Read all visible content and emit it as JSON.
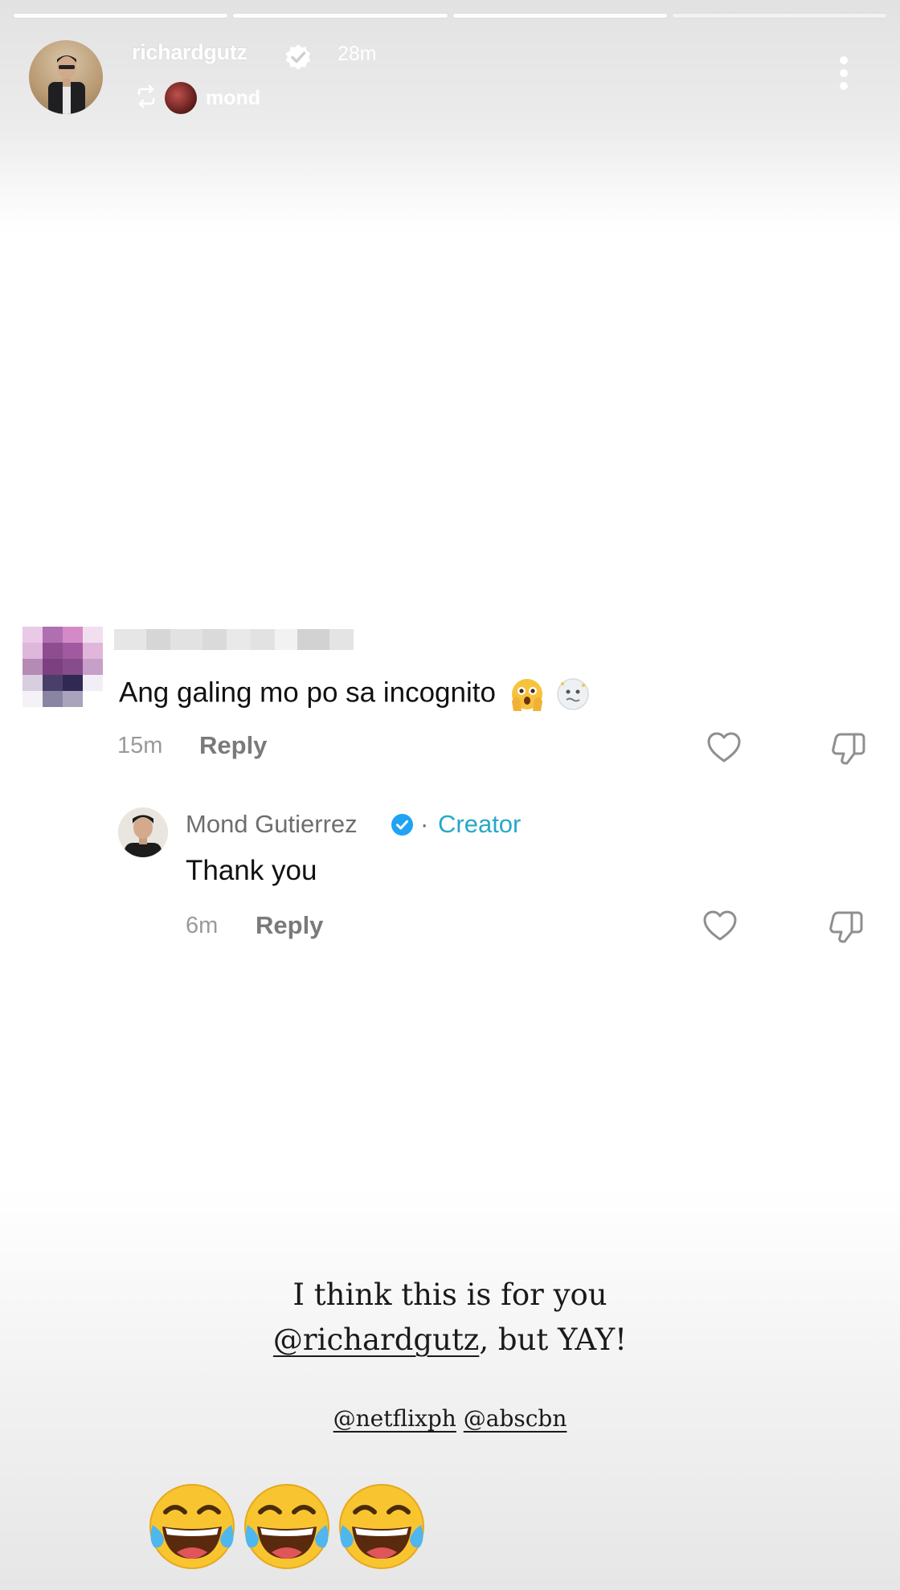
{
  "story": {
    "progress": {
      "total_segments": 4,
      "completed_segments": 3
    },
    "header": {
      "username": "richardgutz",
      "verified": true,
      "time": "28m",
      "reposted_from": "mond"
    },
    "colors": {
      "creator_accent": "#25a9c8",
      "verified_blue": "#20a3f5"
    }
  },
  "comment": {
    "text": "Ang galing mo po sa incognito",
    "emojis": [
      "flushed-face-hands-icon",
      "cold-face-icon"
    ],
    "time": "15m",
    "reply_label": "Reply"
  },
  "reply": {
    "author": "Mond Gutierrez",
    "separator": "·",
    "badge": "Creator",
    "text": "Thank you",
    "time": "6m",
    "reply_label": "Reply"
  },
  "caption": {
    "line1": "I think this is for you",
    "mention": "@richardgutz",
    "line2_rest": ", but YAY!",
    "tags": [
      "@netflixph",
      "@abscbn"
    ]
  },
  "emoji_row": [
    "laughing-tears-icon",
    "laughing-tears-icon",
    "laughing-tears-icon"
  ]
}
